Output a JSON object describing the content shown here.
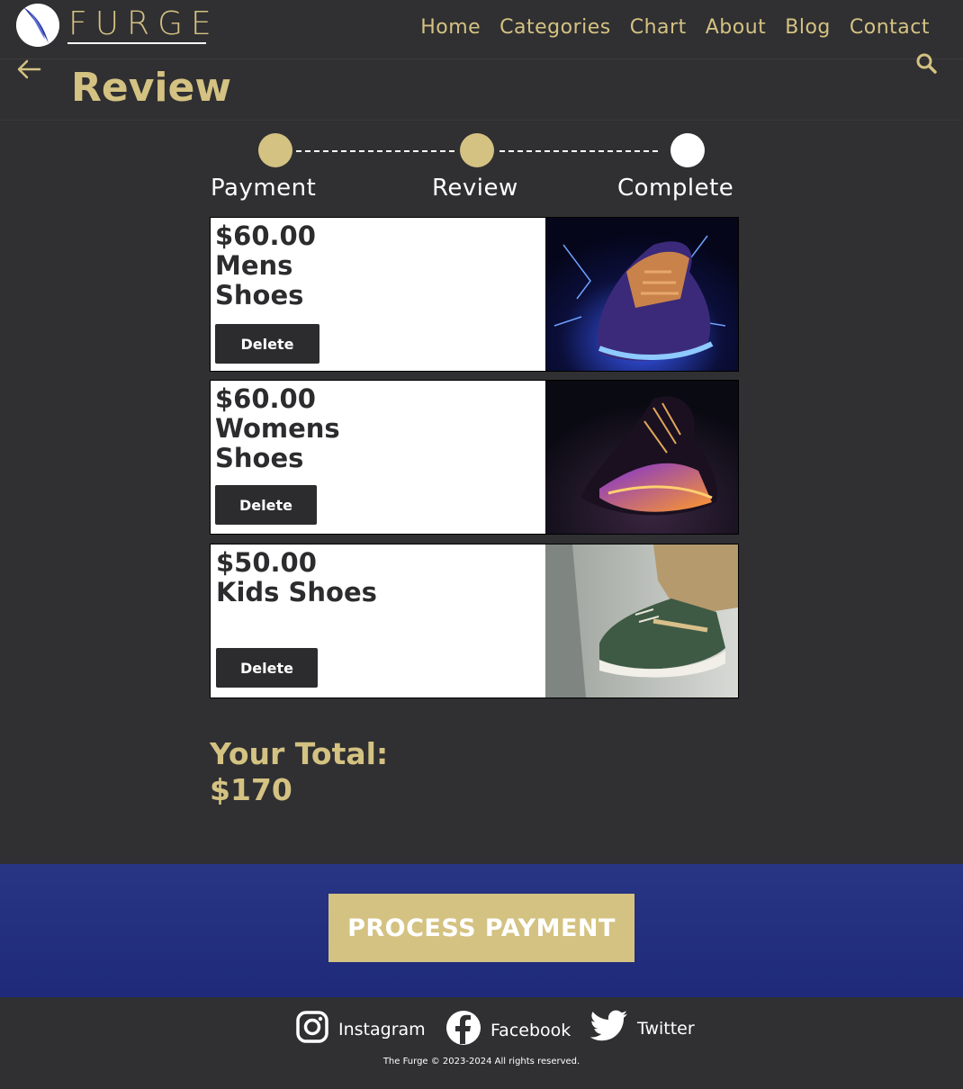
{
  "header": {
    "brand": "FURGE",
    "nav": [
      "Home",
      "Categories",
      "Chart",
      "About",
      "Blog",
      "Contact"
    ]
  },
  "page": {
    "title": "Review"
  },
  "stepper": {
    "steps": [
      "Payment",
      "Review",
      "Complete"
    ],
    "active_color": "#d4c282",
    "inactive_color": "#ffffff"
  },
  "cart": {
    "items": [
      {
        "price": "$60.00",
        "name": "Mens Shoes",
        "delete_label": "Delete"
      },
      {
        "price": "$60.00",
        "name": "Womens Shoes",
        "delete_label": "Delete"
      },
      {
        "price": "$50.00",
        "name": "Kids Shoes",
        "delete_label": "Delete"
      }
    ]
  },
  "summary": {
    "total_label": "Your Total:",
    "total_value": "$170"
  },
  "actions": {
    "process_payment": "PROCESS PAYMENT"
  },
  "footer": {
    "social": [
      "Instagram",
      "Facebook",
      "Twitter"
    ],
    "copyright": "The Furge © 2023-2024 All rights reserved."
  },
  "colors": {
    "accent": "#d4c282",
    "background": "#303032",
    "band": "#283584"
  }
}
